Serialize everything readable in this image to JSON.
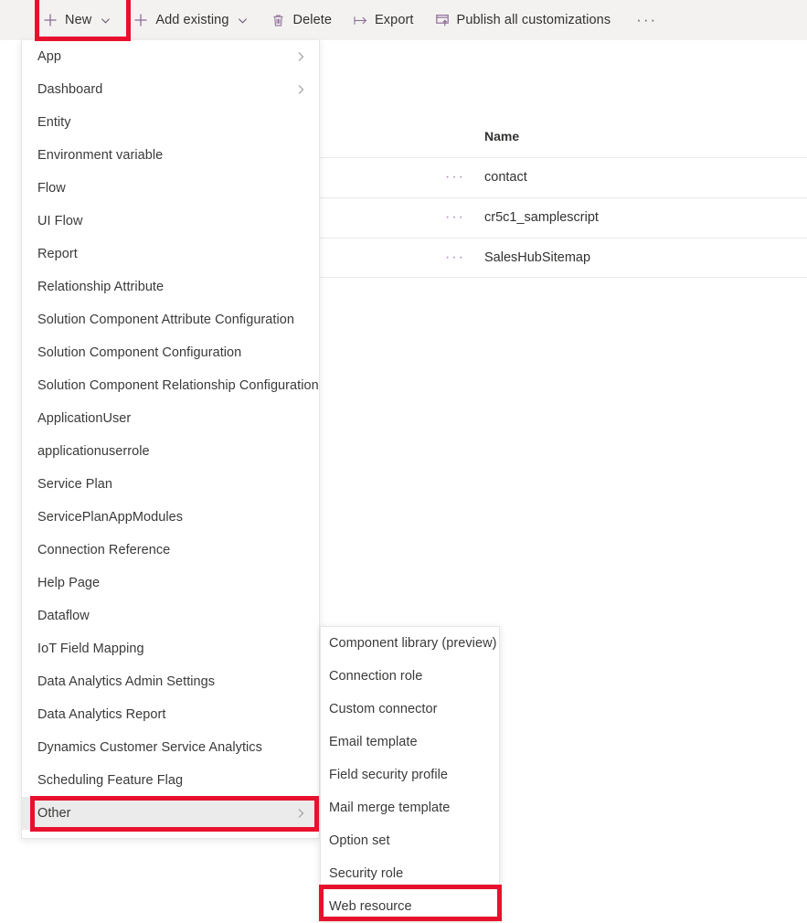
{
  "command_bar": {
    "buttons": [
      {
        "label": "New",
        "icon": "plus-icon",
        "has_caret": true
      },
      {
        "label": "Add existing",
        "icon": "plus-icon",
        "has_caret": true
      },
      {
        "label": "Delete",
        "icon": "trash-icon",
        "has_caret": false
      },
      {
        "label": "Export",
        "icon": "export-icon",
        "has_caret": false
      },
      {
        "label": "Publish all customizations",
        "icon": "publish-icon",
        "has_caret": false
      }
    ],
    "overflow_label": "···",
    "overflow_icon": "ellipsis-icon"
  },
  "grid": {
    "columns": [
      "Name"
    ],
    "row_menu_icon": "ellipsis-icon",
    "row_menu_label": "···",
    "rows": [
      {
        "name": "contact"
      },
      {
        "name": "cr5c1_samplescript"
      },
      {
        "name": "SalesHubSitemap"
      }
    ]
  },
  "new_menu": {
    "items": [
      {
        "label": "App",
        "has_submenu": true
      },
      {
        "label": "Dashboard",
        "has_submenu": true
      },
      {
        "label": "Entity",
        "has_submenu": false
      },
      {
        "label": "Environment variable",
        "has_submenu": false
      },
      {
        "label": "Flow",
        "has_submenu": false
      },
      {
        "label": "UI Flow",
        "has_submenu": false
      },
      {
        "label": "Report",
        "has_submenu": false
      },
      {
        "label": "Relationship Attribute",
        "has_submenu": false
      },
      {
        "label": "Solution Component Attribute Configuration",
        "has_submenu": false
      },
      {
        "label": "Solution Component Configuration",
        "has_submenu": false
      },
      {
        "label": "Solution Component Relationship Configuration",
        "has_submenu": false
      },
      {
        "label": "ApplicationUser",
        "has_submenu": false
      },
      {
        "label": "applicationuserrole",
        "has_submenu": false
      },
      {
        "label": "Service Plan",
        "has_submenu": false
      },
      {
        "label": "ServicePlanAppModules",
        "has_submenu": false
      },
      {
        "label": "Connection Reference",
        "has_submenu": false
      },
      {
        "label": "Help Page",
        "has_submenu": false
      },
      {
        "label": "Dataflow",
        "has_submenu": false
      },
      {
        "label": "IoT Field Mapping",
        "has_submenu": false
      },
      {
        "label": "Data Analytics Admin Settings",
        "has_submenu": false
      },
      {
        "label": "Data Analytics Report",
        "has_submenu": false
      },
      {
        "label": "Dynamics Customer Service Analytics",
        "has_submenu": false
      },
      {
        "label": "Scheduling Feature Flag",
        "has_submenu": false
      },
      {
        "label": "Other",
        "has_submenu": true,
        "highlighted": true
      }
    ]
  },
  "other_submenu": {
    "items": [
      {
        "label": "Component library (preview)"
      },
      {
        "label": "Connection role"
      },
      {
        "label": "Custom connector"
      },
      {
        "label": "Email template"
      },
      {
        "label": "Field security profile"
      },
      {
        "label": "Mail merge template"
      },
      {
        "label": "Option set"
      },
      {
        "label": "Security role"
      },
      {
        "label": "Web resource"
      }
    ]
  },
  "annotations": {
    "color": "#e8112d",
    "boxes": [
      {
        "target": "New command button"
      },
      {
        "target": "Other menu item"
      },
      {
        "target": "Web resource submenu item"
      }
    ]
  },
  "theme": {
    "command_bar_bg": "#f3f2f1",
    "icon_color": "#8f6e96",
    "text_color": "#323130",
    "menu_hover_bg": "#ebebeb",
    "row_divider": "#edebe9"
  }
}
